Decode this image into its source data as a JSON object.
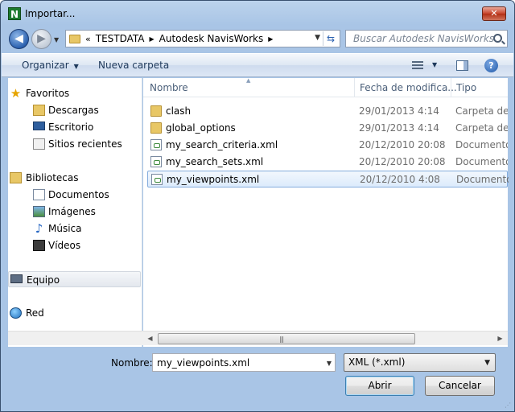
{
  "window": {
    "title": "Importar...",
    "app_icon_letter": "N",
    "close_symbol": "✕"
  },
  "address": {
    "overflow": "«",
    "crumbs": [
      "TESTDATA",
      "Autodesk NavisWorks"
    ],
    "separator": "▶"
  },
  "search": {
    "placeholder": "Buscar Autodesk NavisWorks"
  },
  "toolbar": {
    "organize": "Organizar",
    "new_folder": "Nueva carpeta",
    "help": "?"
  },
  "nav": {
    "favorites": "Favoritos",
    "favorites_items": [
      "Descargas",
      "Escritorio",
      "Sitios recientes"
    ],
    "libraries": "Bibliotecas",
    "libraries_items": [
      "Documentos",
      "Imágenes",
      "Música",
      "Vídeos"
    ],
    "computer": "Equipo",
    "network": "Red"
  },
  "columns": {
    "name": "Nombre",
    "date": "Fecha de modifica...",
    "type": "Tipo"
  },
  "files": [
    {
      "name": "clash",
      "date": "29/01/2013 4:14",
      "type": "Carpeta de archivos",
      "kind": "folder"
    },
    {
      "name": "global_options",
      "date": "29/01/2013 4:14",
      "type": "Carpeta de archivos",
      "kind": "folder"
    },
    {
      "name": "my_search_criteria.xml",
      "date": "20/12/2010 20:08",
      "type": "Documento XML",
      "kind": "xml"
    },
    {
      "name": "my_search_sets.xml",
      "date": "20/12/2010 20:08",
      "type": "Documento XML",
      "kind": "xml"
    },
    {
      "name": "my_viewpoints.xml",
      "date": "20/12/2010 4:08",
      "type": "Documento XML",
      "kind": "xml"
    }
  ],
  "footer": {
    "name_label": "Nombre:",
    "name_value": "my_viewpoints.xml",
    "filter_value": "XML (*.xml)",
    "open_button": "Abrir",
    "cancel_button": "Cancelar"
  }
}
